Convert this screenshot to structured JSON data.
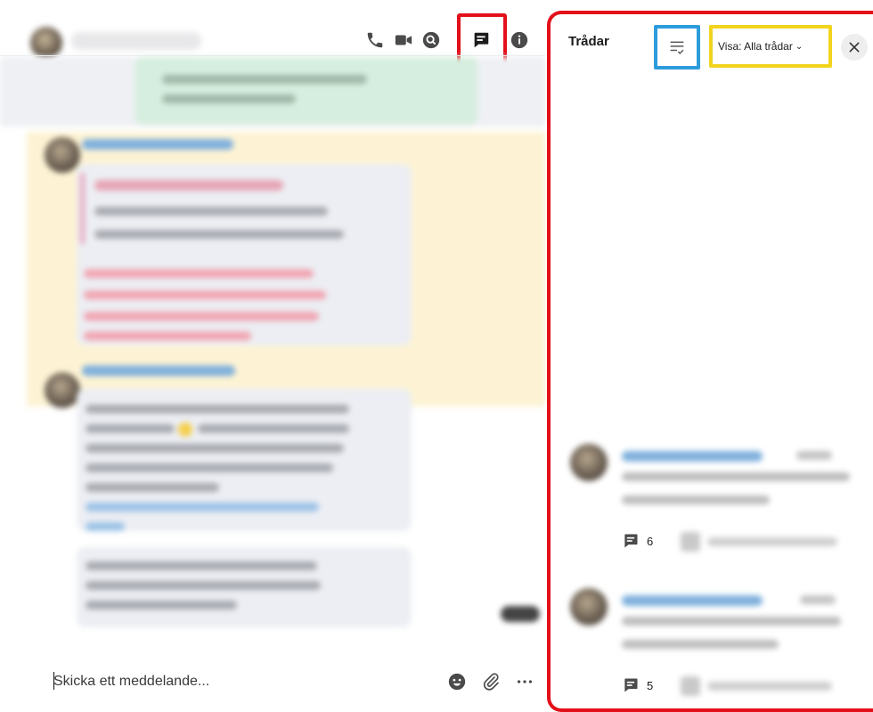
{
  "chat": {
    "composer_placeholder": "Skicka ett meddelande...",
    "header_icons": [
      "phone-icon",
      "video-icon",
      "search-icon",
      "threads-icon",
      "info-icon"
    ]
  },
  "threads_panel": {
    "title": "Trådar",
    "filter_label": "Visa: Alla trådar",
    "threads": [
      {
        "reply_count": "6"
      },
      {
        "reply_count": "5"
      }
    ]
  },
  "colors": {
    "highlight_red": "#e3101a",
    "highlight_blue": "#2d9cdb",
    "highlight_yellow": "#f2d41d",
    "link_blue": "#2d9cdb"
  }
}
